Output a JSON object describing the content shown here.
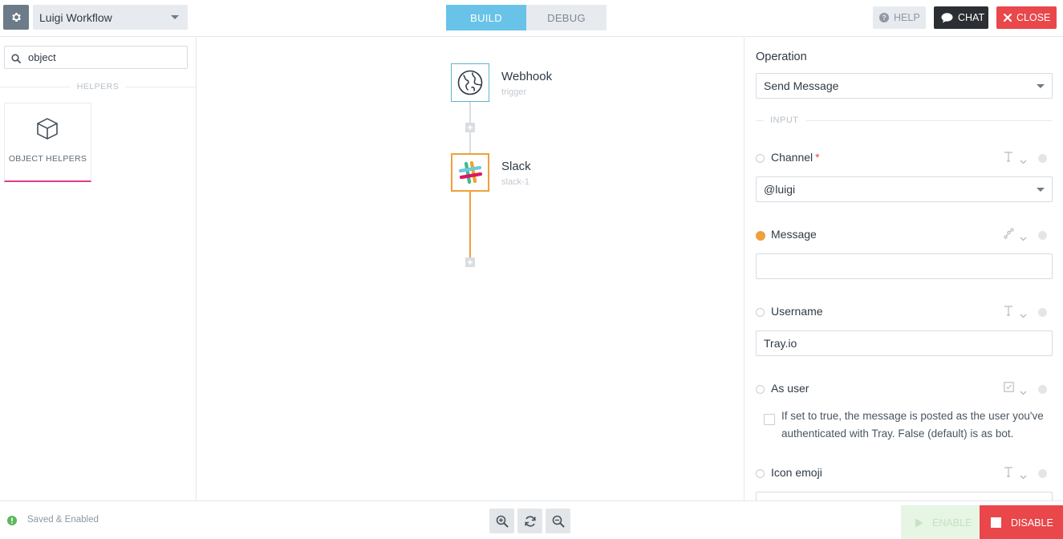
{
  "app": {
    "workflow_name": "Luigi Workflow",
    "icons": {
      "settings": "gear-icon",
      "workflow_dropdown": "caret-down-icon"
    }
  },
  "mode_tabs": [
    {
      "label": "BUILD",
      "active": true
    },
    {
      "label": "DEBUG",
      "active": false
    }
  ],
  "toolbar": {
    "help_label": "HELP",
    "chat_label": "CHAT",
    "close_label": "CLOSE",
    "colors": {
      "close": "#e9474a",
      "chat": "#2b2f33",
      "build_active": "#69c3e8"
    }
  },
  "sidebar": {
    "search": {
      "value": "object",
      "icon": "search-icon"
    },
    "section_label": "HELPERS",
    "helpers": [
      {
        "label": "OBJECT HELPERS",
        "icon": "cube-icon",
        "selected": true
      }
    ]
  },
  "canvas": {
    "nodes": [
      {
        "title": "Webhook",
        "subtitle": "trigger",
        "icon": "globe-icon"
      },
      {
        "title": "Slack",
        "subtitle": "slack-1",
        "icon": "slack-icon"
      }
    ],
    "colors": {
      "trigger_border": "#5fb3cf",
      "selected_border": "#f0a03c"
    }
  },
  "panel": {
    "operation_label": "Operation",
    "operation_value": "Send Message",
    "input_section_label": "INPUT",
    "fields": {
      "channel": {
        "label": "Channel",
        "required_mark": "*",
        "value": "@luigi",
        "type_icon": "text-type-icon"
      },
      "message": {
        "label": "Message",
        "value": "",
        "type_icon": "jsonpath-icon",
        "status": "warning"
      },
      "username": {
        "label": "Username",
        "value": "Tray.io",
        "type_icon": "text-type-icon"
      },
      "as_user": {
        "label": "As user",
        "type_icon": "checkbox-type-icon",
        "checked": false,
        "help": "If set to true, the message is posted as the user you've authenticated with Tray. False (default) is as bot."
      },
      "icon_emoji": {
        "label": "Icon emoji",
        "type_icon": "text-type-icon"
      }
    }
  },
  "bottombar": {
    "status_text": "Saved & Enabled",
    "status_color": "#5cb85c",
    "zoom_controls": [
      "zoom-in-icon",
      "reset-zoom-icon",
      "zoom-out-icon"
    ],
    "enable_label": "ENABLE",
    "disable_label": "DISABLE"
  }
}
